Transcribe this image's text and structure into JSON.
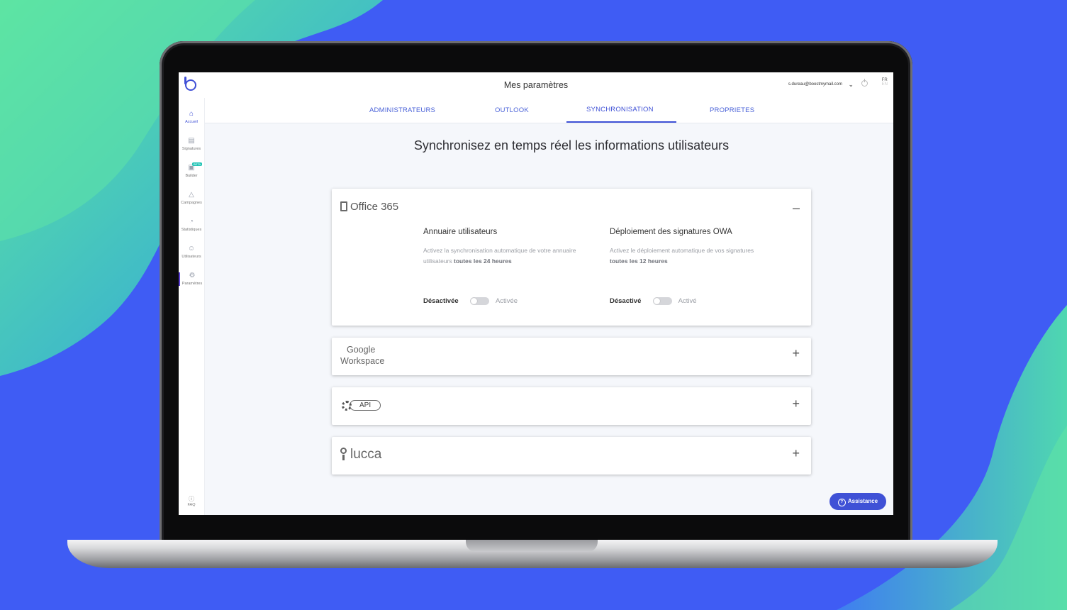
{
  "app": {
    "page_title": "Mes paramètres",
    "user_email": "s.dureau@boostmymail.com",
    "lang_active": "FR",
    "lang_other": "EN"
  },
  "tabs": [
    {
      "label": "ADMINISTRATEURS"
    },
    {
      "label": "OUTLOOK"
    },
    {
      "label": "SYNCHRONISATION"
    },
    {
      "label": "PROPRIETES"
    }
  ],
  "sidebar": {
    "items": [
      {
        "label": "Accueil",
        "icon": "home-icon"
      },
      {
        "label": "Signatures",
        "icon": "signature-icon"
      },
      {
        "label": "Builder",
        "icon": "builder-icon",
        "badge": "BETA"
      },
      {
        "label": "Campagnes",
        "icon": "megaphone-icon"
      },
      {
        "label": "Statistiques",
        "icon": "pie-chart-icon"
      },
      {
        "label": "Utilisateurs",
        "icon": "users-icon"
      },
      {
        "label": "Paramètres",
        "icon": "gear-icon"
      }
    ],
    "faq": "FAQ"
  },
  "main": {
    "heading": "Synchronisez en temps réel les informations utilisateurs",
    "office365": {
      "logo_text": "Office 365",
      "collapse_symbol": "–",
      "directory": {
        "title": "Annuaire utilisateurs",
        "desc": "Activez la synchronisation automatique de votre annuaire utilisateurs ",
        "desc_bold": "toutes les 24 heures",
        "off_label": "Désactivée",
        "on_label": "Activée",
        "enabled": false
      },
      "owa": {
        "title": "Déploiement des signatures OWA",
        "desc": "Activez le déploiement automatique de vos signatures ",
        "desc_bold": "toutes les 12 heures",
        "off_label": "Désactivé",
        "on_label": "Activé",
        "enabled": false
      }
    },
    "google": {
      "line1": "Google",
      "line2": "Workspace",
      "expand_symbol": "+"
    },
    "api": {
      "label": "API",
      "expand_symbol": "+"
    },
    "lucca": {
      "label": "lucca",
      "expand_symbol": "+"
    }
  },
  "assistance": {
    "label": "Assistance",
    "icon": "?"
  },
  "colors": {
    "accent": "#3f51d6",
    "background_blue": "#3f5cf4",
    "wave_green": "#4ee0a0",
    "beta_badge": "#21c3b5"
  }
}
